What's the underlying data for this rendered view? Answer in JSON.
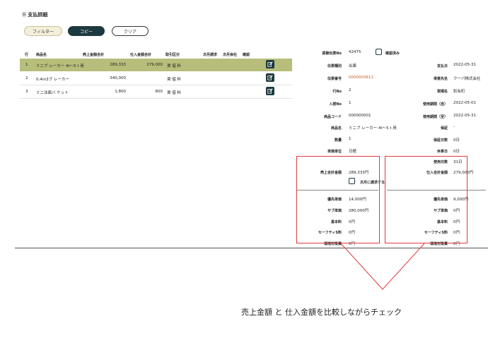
{
  "window": {
    "title": "支払詳細"
  },
  "toolbar": {
    "filter_label": "フィルター",
    "copy_label": "コピー",
    "clear_label": "クリア"
  },
  "table": {
    "headers": {
      "row": "行",
      "product": "商品名",
      "sales_total": "売上金額合計",
      "purchase_total": "仕入金額合計",
      "transaction_type": "取引区分",
      "next_month_billing": "次月請求",
      "next_month_payment": "次月会社",
      "confirm": "確認"
    },
    "rows": [
      {
        "row": "1",
        "product": "ミニブ レーカー 4t〜5 t 用",
        "sales_total": "289,333",
        "purchase_total": "279,000",
        "transaction_type": "賃 借 料"
      },
      {
        "row": "2",
        "product": "0.4m3ブ レーカー",
        "sales_total": "340,000",
        "purchase_total": "",
        "transaction_type": "賃 借 料"
      },
      {
        "row": "3",
        "product": "ミニ法面バ ケット",
        "sales_total": "1,800",
        "purchase_total": "800",
        "transaction_type": "賃 借 料"
      }
    ]
  },
  "detail": {
    "purchase_no_label": "貨御伝票No",
    "purchase_no": "42475",
    "confirmed_label": "確認済み",
    "slip_type_label": "伝票種別",
    "slip_type": "出庫",
    "slip_no_label": "伝票番号",
    "slip_no": "0000003611",
    "line_no_label": "行No",
    "line_no": "2",
    "receipt_no_label": "入替No",
    "receipt_no": "1",
    "product_code_label": "商品コード",
    "product_code": "000000001",
    "product_name_label": "商品名",
    "product_name": "ミニブ レーカー 4t〜5 t 用",
    "quantity_label": "数量",
    "quantity": "1",
    "unit_label": "単価単位",
    "unit": "日極",
    "payment_date_label": "支払日",
    "payment_date": "2022-05-31",
    "supplier_label": "得意先名",
    "supplier": "クーパ株式会社",
    "site_label": "現場名",
    "site": "鈴糸町",
    "period_from_label": "使用期間（自）",
    "period_from": "2022-05-01",
    "period_to_label": "使用期間（至）",
    "period_to": "2022-05-31",
    "guarantee_label": "保証",
    "guarantee": "-",
    "guarantee_days_label": "保証日数",
    "guarantee_days": "0日",
    "holidays_label": "休車日",
    "holidays": "0日",
    "usage_days_label": "使用日数",
    "usage_days": "31日",
    "sales_total_label": "売上合計金額",
    "sales_total": "289,333円",
    "next_month_label": "次月に請求する",
    "purchase_total_label": "仕入合計金額",
    "purchase_total": "279,000円"
  },
  "sales_breakdown": [
    {
      "label": "優先単価",
      "value": "14,000円"
    },
    {
      "label": "サブ単価",
      "value": "280,000円"
    },
    {
      "label": "基本料",
      "value": "0円"
    },
    {
      "label": "セーフティS料",
      "value": "0円"
    },
    {
      "label": "環境対策費",
      "value": "0円"
    }
  ],
  "purchase_breakdown": [
    {
      "label": "優先単価",
      "value": "9,000円"
    },
    {
      "label": "サブ単価",
      "value": "0円"
    },
    {
      "label": "基本料",
      "value": "0円"
    },
    {
      "label": "セーフティS料",
      "value": "0円"
    },
    {
      "label": "環境対策費",
      "value": "0円"
    }
  ],
  "annotation": {
    "caption": "売上金額 と 仕入金額を比較しながらチェック"
  },
  "colors": {
    "accent": "#1d3940",
    "selected_row": "#b7bd7a",
    "highlight_box": "#e0393b",
    "link": "#c0612b"
  }
}
